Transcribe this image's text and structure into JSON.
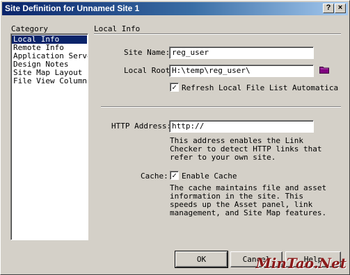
{
  "window": {
    "title": "Site Definition for Unnamed Site 1",
    "help_glyph": "?",
    "close_glyph": "×"
  },
  "category": {
    "label": "Category",
    "items": [
      {
        "label": "Local Info",
        "selected": true
      },
      {
        "label": "Remote Info",
        "selected": false
      },
      {
        "label": "Application Server",
        "selected": false
      },
      {
        "label": "Design Notes",
        "selected": false
      },
      {
        "label": "Site Map Layout",
        "selected": false
      },
      {
        "label": "File View Columns",
        "selected": false
      }
    ]
  },
  "panel": {
    "title": "Local Info",
    "site_name_label": "Site Name:",
    "site_name_value": "reg_user",
    "local_root_label": "Local Root",
    "local_root_value": "H:\\temp\\reg_user\\",
    "folder_icon": "folder-icon",
    "refresh_checked": true,
    "refresh_label": "Refresh Local File List Automatica",
    "http_label": "HTTP Address:",
    "http_value": "http://",
    "http_desc": [
      "This address enables the Link",
      "Checker to detect HTTP links that",
      "refer to your own site."
    ],
    "cache_label": "Cache:",
    "cache_checked": true,
    "cache_option_label": "Enable Cache",
    "cache_desc": [
      "The cache maintains file and asset",
      "information in the site.  This",
      "speeds up the Asset panel, link",
      "management, and Site Map features."
    ]
  },
  "buttons": {
    "ok": "OK",
    "cancel": "Cancel",
    "help": "Help"
  },
  "watermark": "MinTao.Net",
  "colors": {
    "face": "#d4d0c8",
    "title_start": "#0a246a",
    "title_end": "#a6caf0",
    "selection": "#0a246a",
    "folder": "#800080",
    "watermark": "#8b1a1a"
  }
}
